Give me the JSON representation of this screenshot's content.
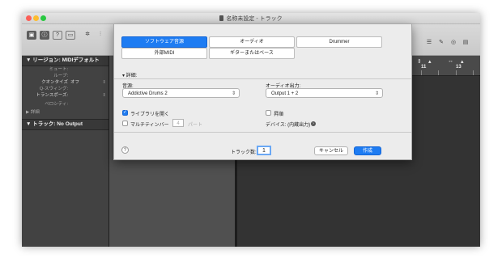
{
  "window": {
    "title": "名称未設定 - トラック",
    "traffic_colors": [
      "#fc5f57",
      "#fdbc2e",
      "#28c840"
    ]
  },
  "inspector": {
    "region_header": "リージョン: MIDIデフォルト",
    "rows": [
      {
        "label": "ミュート:",
        "value": ""
      },
      {
        "label": "ループ:",
        "value": ""
      },
      {
        "label": "クオンタイズ",
        "value": "オフ"
      },
      {
        "label": "Q-スウィング:",
        "value": ""
      },
      {
        "label": "トランスポーズ:",
        "value": ""
      },
      {
        "label": "ベロシティ:",
        "value": ""
      }
    ],
    "detail_label": "詳細",
    "track_header": "トラック: No Output"
  },
  "ruler": {
    "numbers": [
      "11",
      "13"
    ]
  },
  "sheet": {
    "type_buttons": [
      "ソフトウェア音源",
      "オーディオ",
      "Drummer",
      "外部MIDI",
      "ギターまたはベース"
    ],
    "details_label": "▾ 詳細:",
    "source_label": "音源:",
    "source_value": "Addictive Drums 2",
    "output_label": "オーディオ出力:",
    "output_value": "Output 1 + 2",
    "open_library_label": "ライブラリを開く",
    "multitimbral_label": "マルチティンバー",
    "multitimbral_value": "4",
    "parts_label": "パート",
    "ascending_label": "昇順",
    "device_label": "デバイス: (内蔵出力)",
    "track_count_label": "トラック数:",
    "track_count_value": "1",
    "cancel_label": "キャンセル",
    "create_label": "作成",
    "help_label": "?"
  }
}
